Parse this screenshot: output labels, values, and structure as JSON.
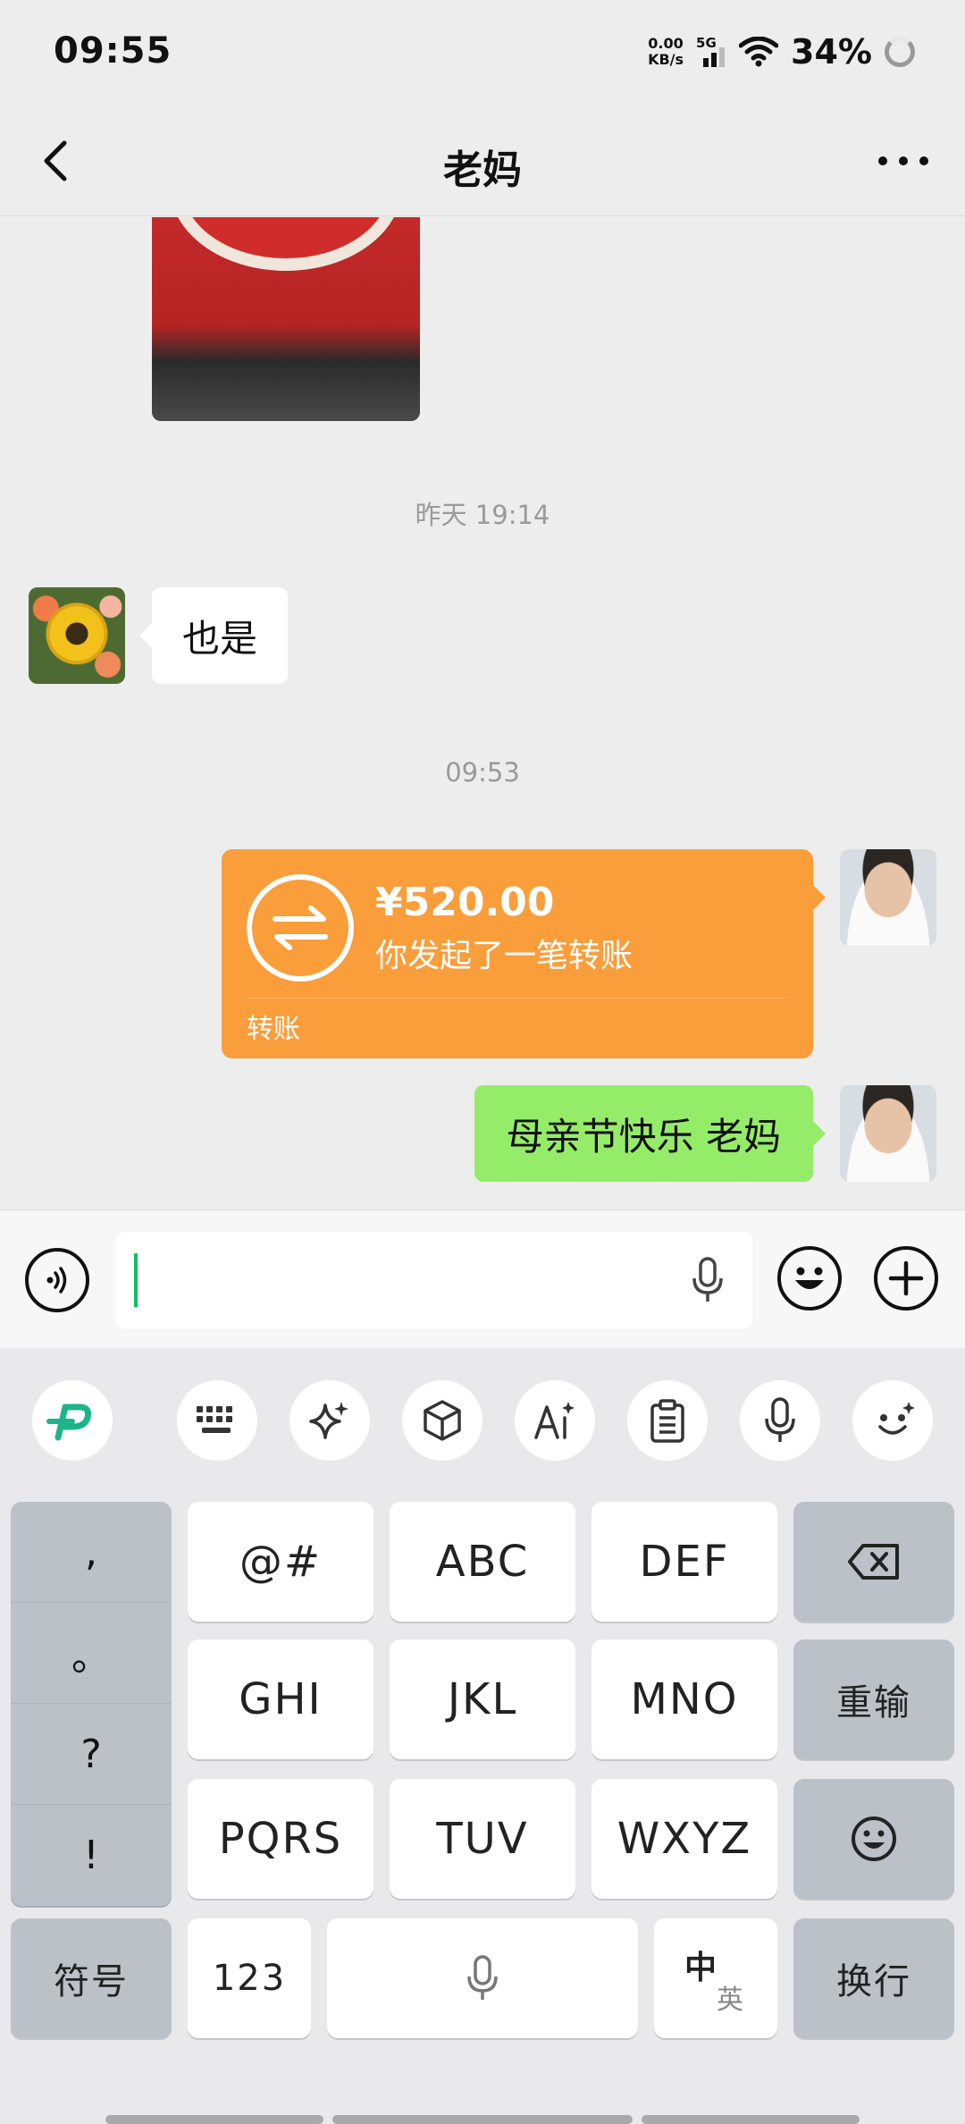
{
  "status_bar": {
    "time": "09:55",
    "net_speed": "0.00",
    "net_unit": "KB/s",
    "signal": "5G",
    "battery": "34%"
  },
  "header": {
    "title": "老妈"
  },
  "messages": {
    "time_yesterday": "昨天 19:14",
    "mom_text": "也是",
    "time_today": "09:53",
    "transfer_amount": "¥520.00",
    "transfer_desc": "你发起了一笔转账",
    "transfer_label": "转账",
    "my_text": "母亲节快乐 老妈"
  },
  "input": {
    "value": ""
  },
  "keyboard": {
    "punctuation": [
      ",",
      "。",
      "?",
      "!"
    ],
    "rows": [
      [
        "@#",
        "ABC",
        "DEF"
      ],
      [
        "GHI",
        "JKL",
        "MNO"
      ],
      [
        "PQRS",
        "TUV",
        "WXYZ"
      ]
    ],
    "retype": "重输",
    "symbols": "符号",
    "numbers": "123",
    "lang_zh": "中",
    "lang_en": "英",
    "enter": "换行"
  },
  "colors": {
    "wechat_green": "#07c160",
    "bubble_green": "#95ec69",
    "transfer_orange": "#fa9d3b"
  }
}
